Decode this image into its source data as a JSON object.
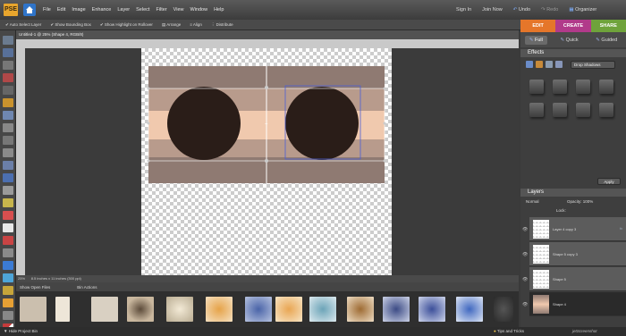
{
  "app": {
    "logo": "PSE"
  },
  "menu": [
    "File",
    "Edit",
    "Image",
    "Enhance",
    "Layer",
    "Select",
    "Filter",
    "View",
    "Window",
    "Help"
  ],
  "top_right": {
    "sign_in": "Sign In",
    "join_now": "Join Now",
    "undo": "Undo",
    "redo": "Redo",
    "organizer": "Organizer"
  },
  "options": {
    "auto_select": "Auto Select Layer",
    "bounding_box": "Show Bounding Box",
    "highlight": "Show Highlight on Rollover",
    "arrange": "Arrange",
    "align": "Align",
    "distribute": "Distribute"
  },
  "mode_tabs": [
    {
      "label": "EDIT",
      "color": "#e5762a"
    },
    {
      "label": "CREATE",
      "color": "#b13a8a"
    },
    {
      "label": "SHARE",
      "color": "#6fa33b"
    }
  ],
  "edit_tabs": [
    "Full",
    "Quick",
    "Guided"
  ],
  "document": {
    "tab": "Untitled-1 @ 25% (Shape 4, RGB/8)",
    "zoom": "25%",
    "size": "8.5 inches x 11 inches (300 ppi)"
  },
  "bin": {
    "show": "Show Open Files",
    "actions": "Bin Actions"
  },
  "effects": {
    "title": "Effects",
    "dropdown": "Drop Shadows",
    "apply": "Apply"
  },
  "layers": {
    "title": "Layers",
    "blend": "Normal",
    "opacity_label": "Opacity:",
    "opacity": "100%",
    "lock": "Lock:",
    "rows": [
      {
        "name": "Layer 4 copy 3"
      },
      {
        "name": "Shape 5 copy 3"
      },
      {
        "name": "Shape 5"
      },
      {
        "name": "Shape 4"
      }
    ]
  },
  "bottom": {
    "hide_bin": "Hide Project Bin",
    "tips": "Tips and Tricks",
    "watermark": "jetScreenshot"
  }
}
